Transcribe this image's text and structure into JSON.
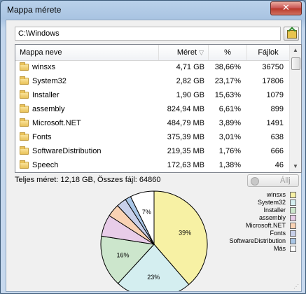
{
  "window": {
    "title": "Mappa mérete",
    "close_glyph": "✕"
  },
  "path": {
    "value": "C:\\Windows"
  },
  "table": {
    "columns": {
      "name": "Mappa neve",
      "size": "Méret",
      "sort_glyph": "▽",
      "percent": "%",
      "files": "Fájlok"
    },
    "rows": [
      {
        "name": "winsxs",
        "size": "4,71 GB",
        "percent": "38,66%",
        "files": "36750"
      },
      {
        "name": "System32",
        "size": "2,82 GB",
        "percent": "23,17%",
        "files": "17806"
      },
      {
        "name": "Installer",
        "size": "1,90 GB",
        "percent": "15,63%",
        "files": "1079"
      },
      {
        "name": "assembly",
        "size": "824,94 MB",
        "percent": "6,61%",
        "files": "899"
      },
      {
        "name": "Microsoft.NET",
        "size": "484,79 MB",
        "percent": "3,89%",
        "files": "1491"
      },
      {
        "name": "Fonts",
        "size": "375,39 MB",
        "percent": "3,01%",
        "files": "638"
      },
      {
        "name": "SoftwareDistribution",
        "size": "219,35 MB",
        "percent": "1,76%",
        "files": "666"
      },
      {
        "name": "Speech",
        "size": "172,63 MB",
        "percent": "1,38%",
        "files": "46"
      }
    ]
  },
  "status": {
    "text": "Teljes méret: 12,18 GB,  Összes fájl: 64860",
    "stop_label": "Állj"
  },
  "chart_data": {
    "type": "pie",
    "labels": [
      "winsxs",
      "System32",
      "Installer",
      "assembly",
      "Microsoft.NET",
      "Fonts",
      "SoftwareDistribution",
      "Más"
    ],
    "values": [
      38.66,
      23.17,
      15.63,
      6.61,
      3.89,
      3.01,
      1.76,
      7.27
    ],
    "colors": [
      "#f7f1a4",
      "#d4eef0",
      "#cce6cc",
      "#e8cce8",
      "#f9d2b4",
      "#c8d0ea",
      "#a9c6e6",
      "#ffffff"
    ],
    "data_labels": [
      "39%",
      "23%",
      "16%",
      "",
      "",
      "",
      "",
      "7%"
    ],
    "legend_position": "right"
  }
}
